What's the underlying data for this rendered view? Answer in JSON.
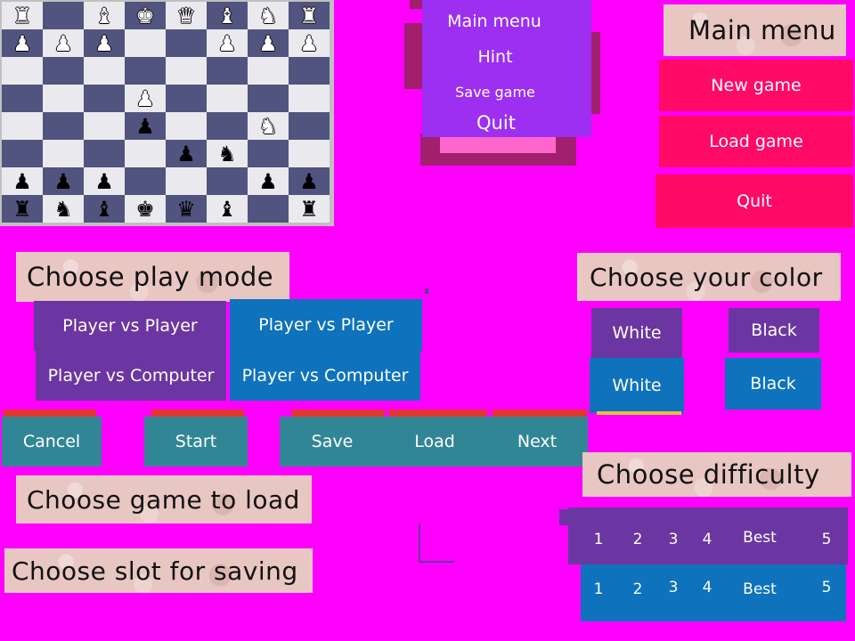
{
  "board": {
    "rows": [
      [
        "wR",
        "",
        "wB",
        "wK",
        "wQ",
        "wB",
        "wN",
        "wR"
      ],
      [
        "wP",
        "wP",
        "wP",
        "",
        "",
        "wP",
        "wP",
        "wP"
      ],
      [
        "",
        "",
        "",
        "",
        "",
        "",
        "",
        ""
      ],
      [
        "",
        "",
        "",
        "wP",
        "",
        "",
        "",
        ""
      ],
      [
        "",
        "",
        "",
        "bP",
        "",
        "",
        "wN",
        ""
      ],
      [
        "",
        "",
        "",
        "",
        "bP",
        "bN",
        "",
        ""
      ],
      [
        "bP",
        "bP",
        "bP",
        "",
        "",
        "",
        "bP",
        "bP"
      ],
      [
        "bR",
        "bN",
        "bB",
        "bK",
        "bQ",
        "bB",
        "",
        "bR"
      ]
    ],
    "glyphs": {
      "K": "♚",
      "Q": "♛",
      "R": "♜",
      "B": "♝",
      "N": "♞",
      "P": "♟"
    }
  },
  "ingame_menu": {
    "main_menu": "Main menu",
    "hint": "Hint",
    "save_game": "Save game",
    "quit": "Quit"
  },
  "main_menu": {
    "title": "Main menu",
    "new_game": "New game",
    "load_game": "Load game",
    "quit": "Quit"
  },
  "play_mode": {
    "title": "Choose play mode",
    "pvp": "Player vs Player",
    "pvp_selected": "Player vs Player",
    "pvc": "Player vs Computer",
    "pvc_selected": "Player vs Computer"
  },
  "color": {
    "title": "Choose your color",
    "white": "White",
    "black": "Black",
    "white_selected": "White",
    "black_selected": "Black"
  },
  "actions": {
    "cancel": "Cancel",
    "start": "Start",
    "save": "Save",
    "load": "Load",
    "next": "Next"
  },
  "load_title": "Choose game to load",
  "save_title": "Choose slot for saving",
  "difficulty": {
    "title": "Choose difficulty",
    "levels": [
      "1",
      "2",
      "3",
      "4",
      "Best",
      "5"
    ],
    "levels_selected": [
      "1",
      "2",
      "3",
      "4",
      "Best",
      "5"
    ]
  },
  "colors": {
    "background": "#ff00ff",
    "dark_square": "#51547e",
    "light_square": "#eae9ee",
    "purple_button": "#6b36a1",
    "blue_button": "#0e72bd",
    "teal_button": "#318696",
    "red_strip": "#e2372f",
    "pink_button": "#ff0a66",
    "violet_menu": "#9c2ff0"
  }
}
